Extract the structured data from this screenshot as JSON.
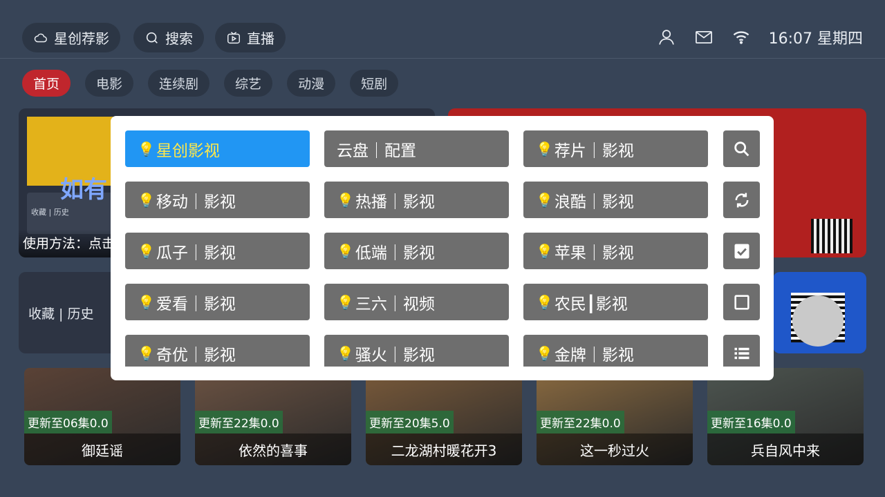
{
  "topbar": {
    "home_pill": "星创荐影",
    "search_pill": "搜索",
    "live_pill": "直播",
    "time": "16:07",
    "weekday": "星期四"
  },
  "tabs": [
    "首页",
    "电影",
    "连续剧",
    "综艺",
    "动漫",
    "短剧"
  ],
  "banner_left": {
    "caption": "使用方法：点击",
    "mini_history": "收藏 | 历史",
    "big_text": "如有"
  },
  "history_card": "收藏 | 历史",
  "posters": [
    {
      "badge": "更新至06集0.0",
      "title": "御廷谣",
      "color": "#5a4236"
    },
    {
      "badge": "更新至22集0.0",
      "title": "依然的喜事",
      "color": "#6b5242"
    },
    {
      "badge": "更新至20集5.0",
      "title": "二龙湖村暖花开3",
      "color": "#7a5a3a"
    },
    {
      "badge": "更新至22集0.0",
      "title": "这一秒过火",
      "color": "#8a6a40"
    },
    {
      "badge": "更新至16集0.0",
      "title": "兵自风中来",
      "color": "#4d5550"
    }
  ],
  "dialog": {
    "sources": [
      [
        "星创影视",
        "云盘｜配置",
        "荐片｜影视"
      ],
      [
        "移动｜影视",
        "热播｜影视",
        "浪酷｜影视"
      ],
      [
        "瓜子｜影视",
        "低端｜影视",
        "苹果｜影视"
      ],
      [
        "爱看｜影视",
        "三六｜视频",
        "农民┃影视"
      ],
      [
        "奇优｜影视",
        "骚火｜影视",
        "金牌｜影视"
      ]
    ],
    "bulb_rows": [
      [
        true,
        false,
        true
      ],
      [
        true,
        true,
        true
      ],
      [
        true,
        true,
        true
      ],
      [
        true,
        true,
        true
      ],
      [
        true,
        true,
        true
      ]
    ],
    "selected": "星创影视",
    "actions": [
      "search-icon",
      "refresh-icon",
      "checkbox-checked-icon",
      "checkbox-empty-icon",
      "list-icon"
    ]
  }
}
